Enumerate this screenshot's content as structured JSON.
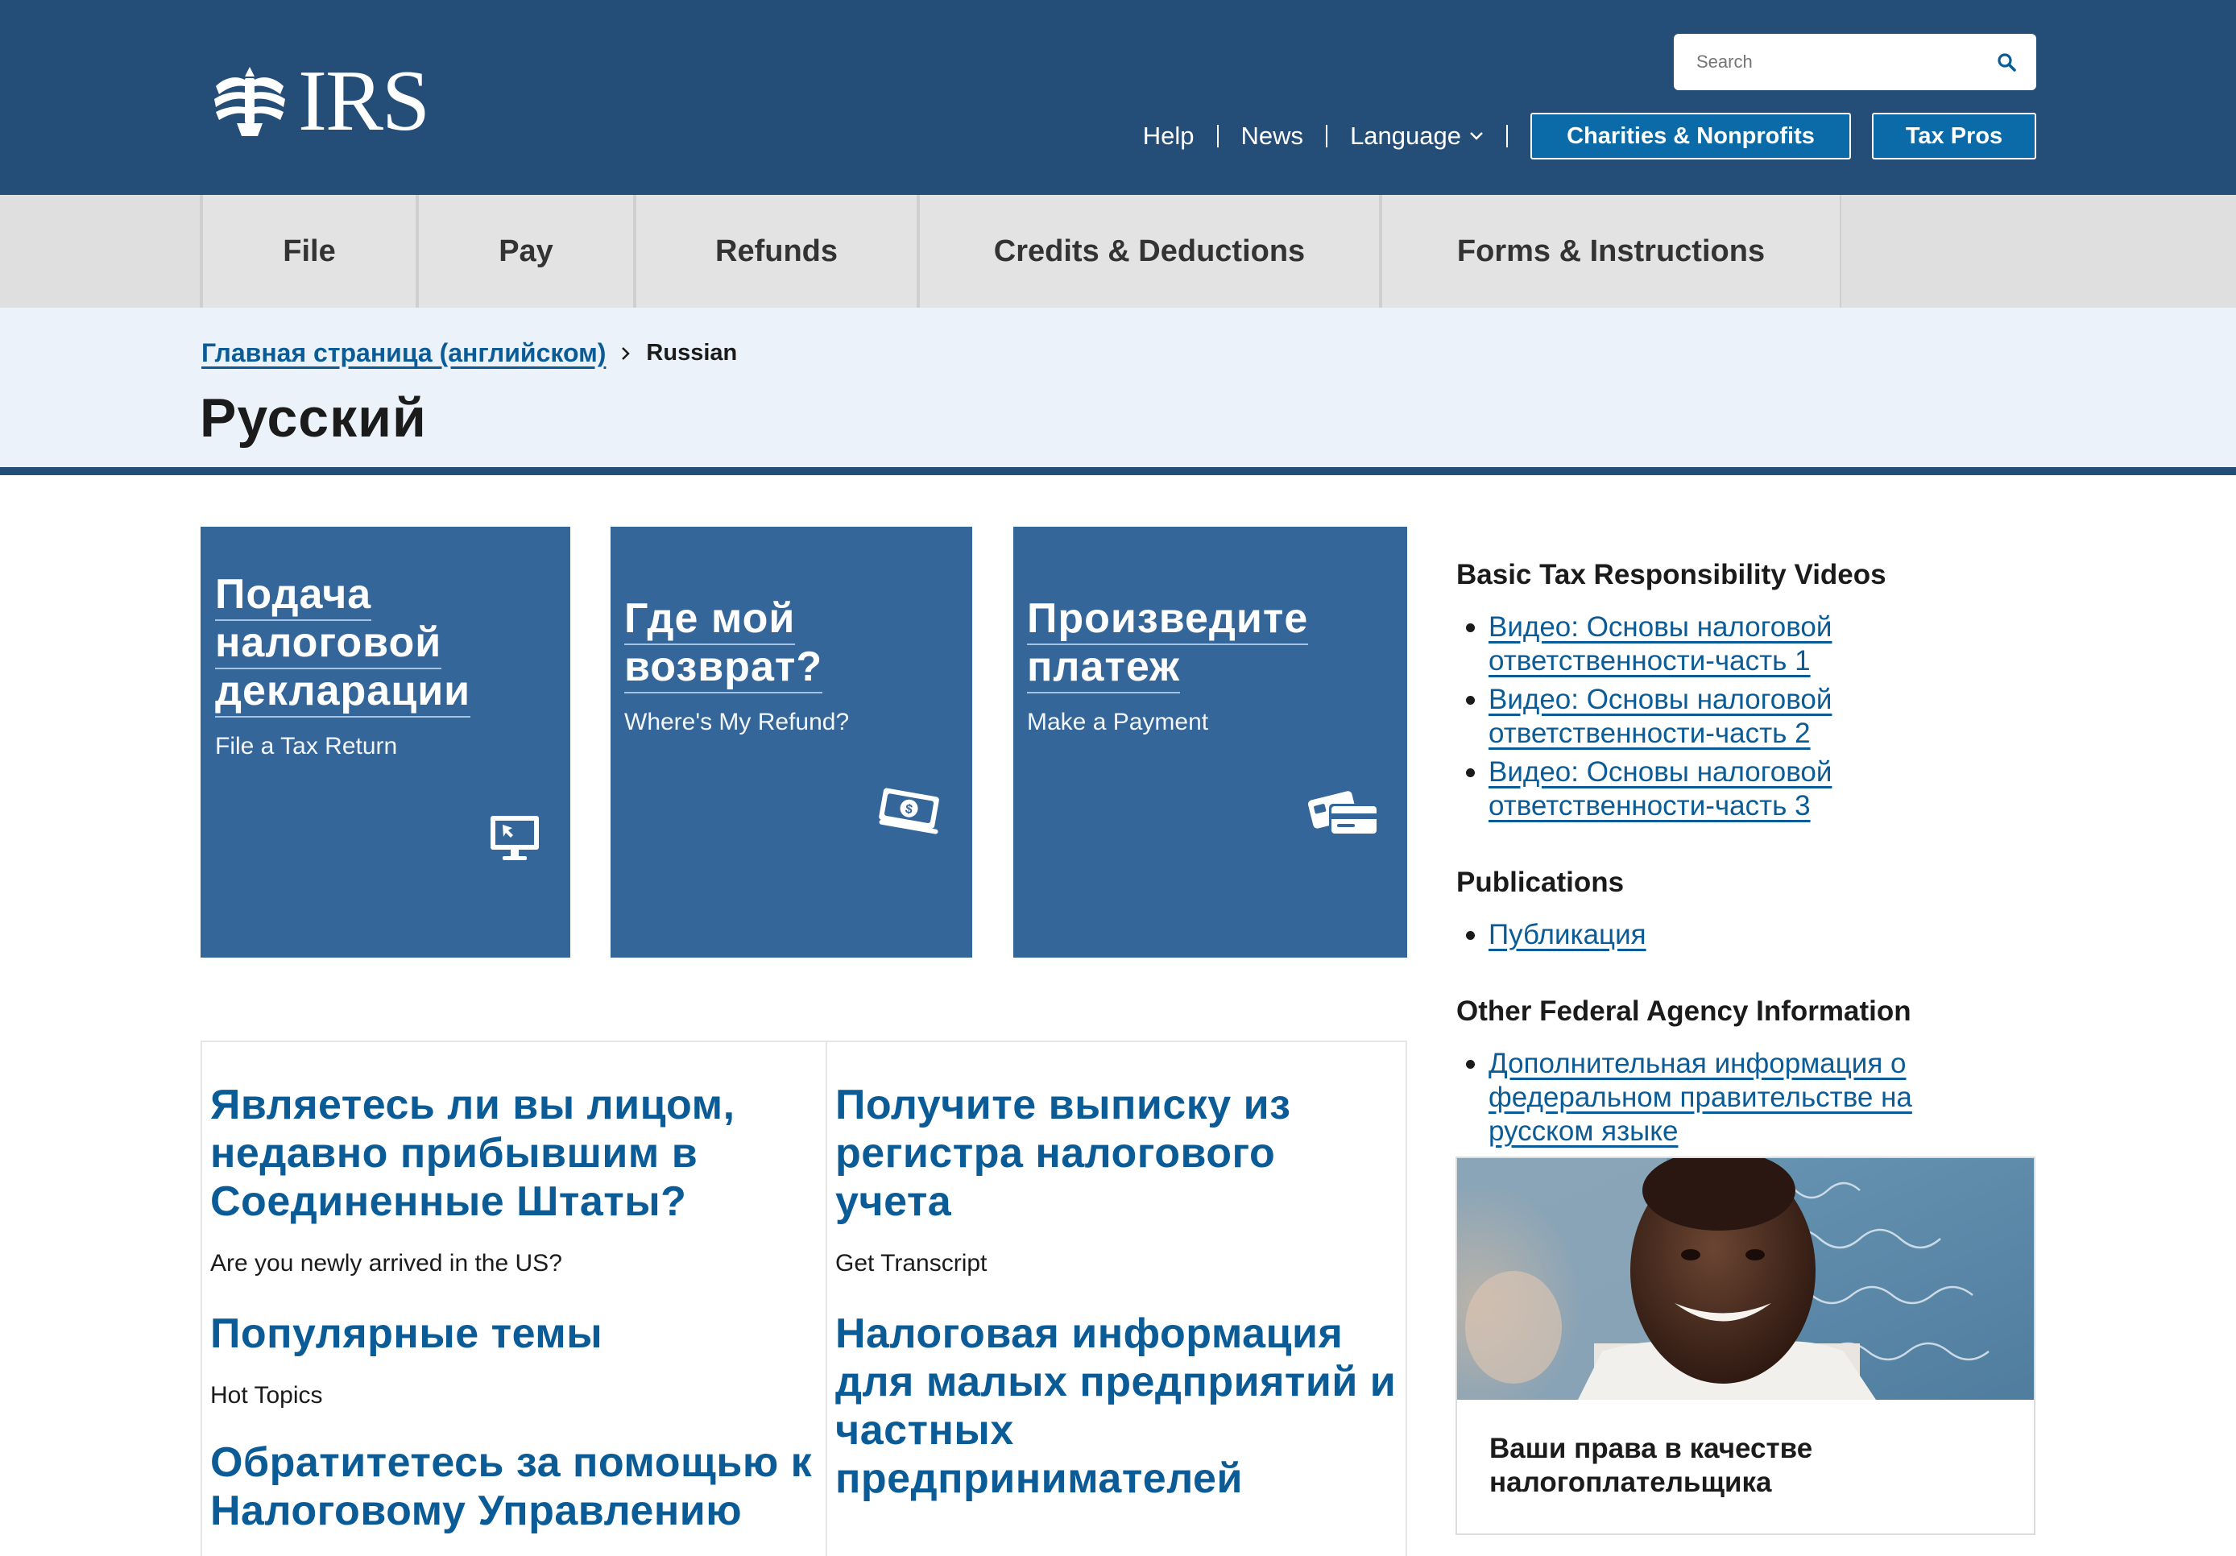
{
  "header": {
    "logo_text": "IRS",
    "search": {
      "placeholder": "Search"
    },
    "utility_links": {
      "help": "Help",
      "news": "News",
      "language": "Language"
    },
    "buttons": {
      "charities": "Charities & Nonprofits",
      "tax_pros": "Tax Pros"
    }
  },
  "nav": {
    "items": [
      {
        "label": "File"
      },
      {
        "label": "Pay"
      },
      {
        "label": "Refunds"
      },
      {
        "label": "Credits & Deductions"
      },
      {
        "label": "Forms & Instructions"
      }
    ]
  },
  "breadcrumb": {
    "home": "Главная страница (английском)",
    "current": "Russian"
  },
  "page_title": "Русский",
  "tiles": [
    {
      "title_lines": [
        "Подача",
        "налоговой",
        "декларации"
      ],
      "subtitle": "File a Tax Return",
      "icon": "computer-icon"
    },
    {
      "title_lines": [
        "Где мой",
        "возврат?"
      ],
      "subtitle": "Where's My Refund?",
      "icon": "money-icon"
    },
    {
      "title_lines": [
        "Произведите",
        "платеж"
      ],
      "subtitle": "Make a Payment",
      "icon": "payment-card-icon"
    }
  ],
  "content": {
    "left": [
      {
        "heading": "Являетесь ли вы лицом, недавно прибывшим в Соединенные Штаты?",
        "sub": "Are you newly arrived in the US?"
      },
      {
        "heading": "Популярные темы",
        "sub": "Hot Topics"
      },
      {
        "heading": "Обратитетесь за помощью к Налоговому Управлению",
        "sub": ""
      }
    ],
    "right": [
      {
        "heading": "Получите выписку из регистра налогового учета",
        "sub": "Get Transcript"
      },
      {
        "heading": "Налоговая информация для малых предприятий и частных предпринимателей",
        "sub": ""
      }
    ]
  },
  "sidebar": {
    "videos": {
      "heading": "Basic Tax Responsibility Videos",
      "links": [
        "Видео: Основы налоговой ответственности-часть 1",
        "Видео: Основы налоговой ответственности-часть 2",
        "Видео: Основы налоговой ответственности-часть 3"
      ]
    },
    "publications": {
      "heading": "Publications",
      "links": [
        "Публикация"
      ]
    },
    "federal": {
      "heading": "Other Federal Agency Information",
      "links": [
        "Дополнительная информация о федеральном правительстве на русском языке"
      ]
    },
    "rights_card": {
      "title": "Ваши права в качестве налогоплательщика"
    }
  },
  "colors": {
    "header_bg": "#244e78",
    "tile_bg": "#346699",
    "link": "#0b5c96",
    "button_bg": "#0b6aa8",
    "nav_bg": "#e3e3e3",
    "title_band_bg": "#ebf2f9"
  }
}
